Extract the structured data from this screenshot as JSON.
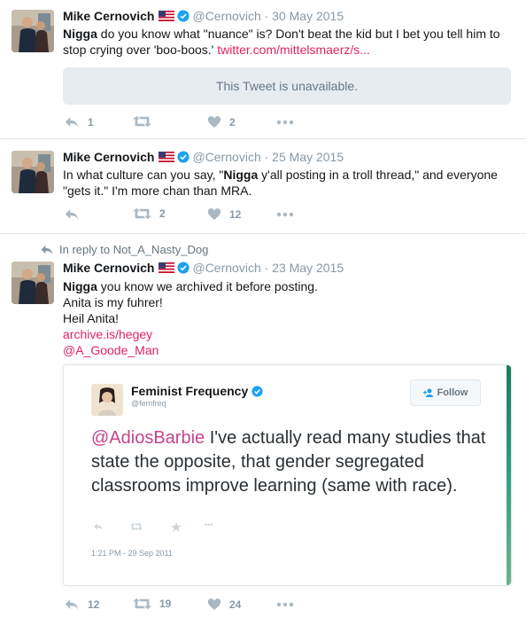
{
  "colors": {
    "link": "#e0245e",
    "meta": "#8899a6",
    "verified": "#1da1f2"
  },
  "icons": {
    "reply": "reply-icon",
    "retweet": "retweet-icon",
    "like": "heart-icon",
    "more": "more-icon",
    "flag": "us-flag-icon",
    "verified": "verified-badge-icon"
  },
  "tweets": [
    {
      "name": "Mike Cernovich",
      "handle": "@Cernovich",
      "date": "· 30 May 2015",
      "bold": "Nigga",
      "text": " do you know what \"nuance\" is? Don't beat the kid but I bet you tell him to stop crying over 'boo-boos.' ",
      "link": "twitter.com/mittelsmaerz/s...",
      "unavailable": "This Tweet is unavailable.",
      "replies": "1",
      "retweets": "",
      "likes": "2",
      "more": "•••"
    },
    {
      "name": "Mike Cernovich",
      "handle": "@Cernovich",
      "date": "· 25 May 2015",
      "text_before": "In what culture can you say, \"",
      "bold": "Nigga",
      "text_after": " y'all posting in a troll thread,\" and everyone \"gets it.\" I'm more chan than MRA.",
      "replies": "",
      "retweets": "2",
      "likes": "12",
      "more": "•••"
    },
    {
      "reply_context": "In reply to Not_A_Nasty_Dog",
      "name": "Mike Cernovich",
      "handle": "@Cernovich",
      "date": "· 23 May 2015",
      "bold": "Nigga",
      "line1": " you know we archived it before posting.",
      "line2": "Anita is my fuhrer!",
      "line3": "Heil Anita!",
      "link1": "archive.is/hegey",
      "link2": "@A_Goode_Man",
      "replies": "12",
      "retweets": "19",
      "likes": "24",
      "more": "•••"
    }
  ],
  "embed": {
    "name": "Feminist Frequency",
    "handle": "@femfreq",
    "follow": "Follow",
    "mention": "@AdiosBarbie",
    "text": " I've actually read many studies that state the opposite, that gender segregated classrooms improve learning (same with race).",
    "more": "•••",
    "date": "1:21 PM - 29 Sep 2011"
  }
}
